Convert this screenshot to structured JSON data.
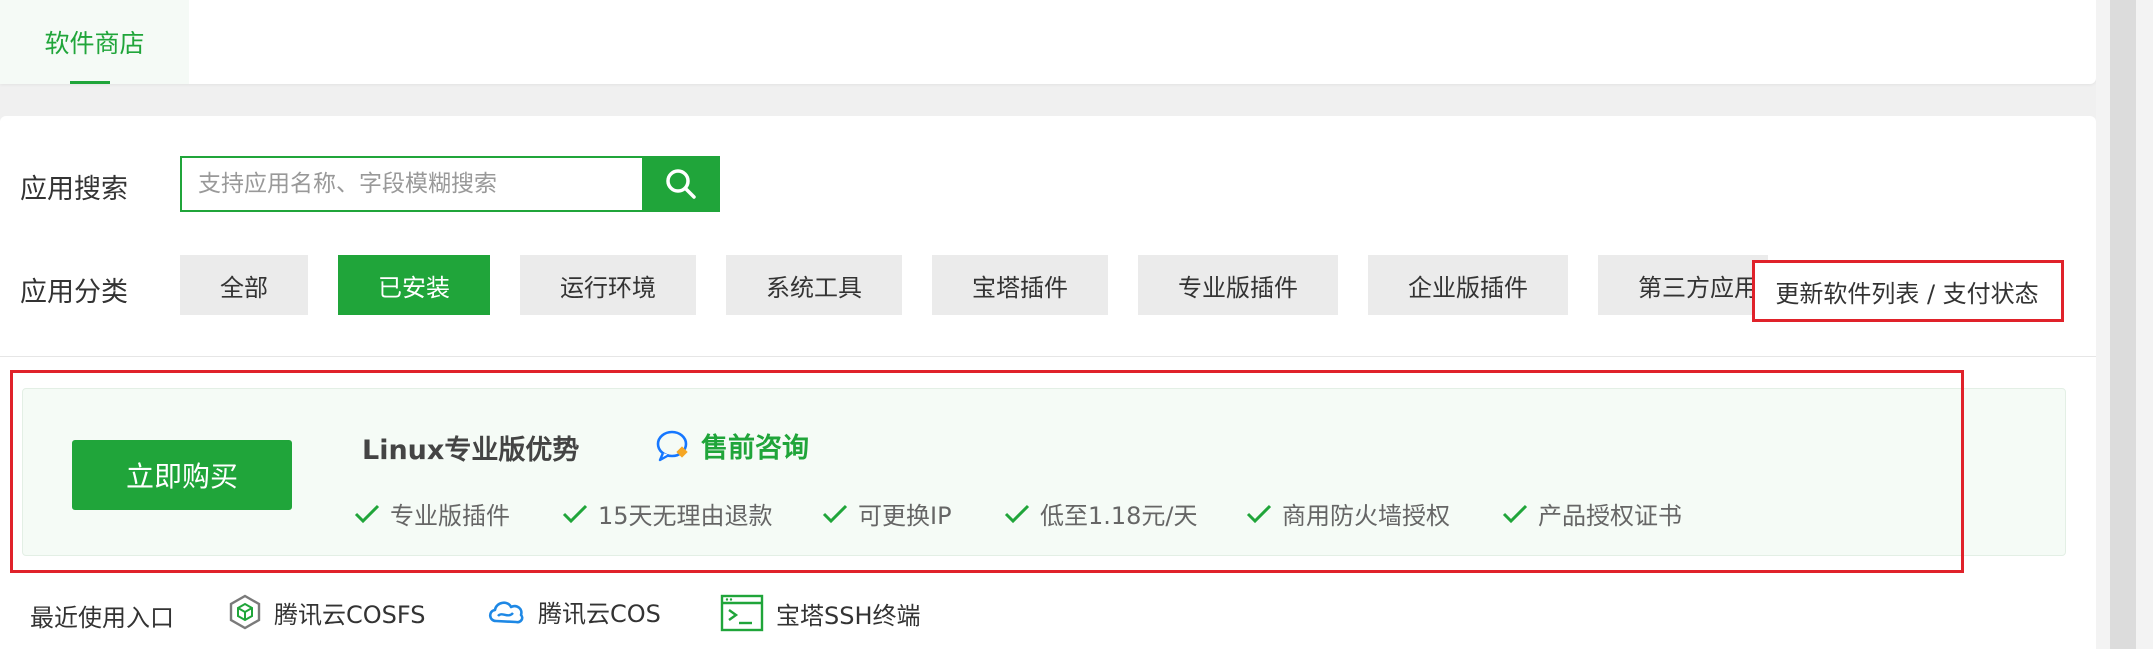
{
  "top_tabs": {
    "store": "软件商店"
  },
  "search": {
    "label": "应用搜索",
    "placeholder": "支持应用名称、字段模糊搜索",
    "value": ""
  },
  "category": {
    "label": "应用分类",
    "items": [
      {
        "label": "全部"
      },
      {
        "label": "已安装",
        "active": true
      },
      {
        "label": "运行环境"
      },
      {
        "label": "系统工具"
      },
      {
        "label": "宝塔插件"
      },
      {
        "label": "专业版插件"
      },
      {
        "label": "企业版插件"
      },
      {
        "label": "第三方应用"
      }
    ],
    "update_label": "更新软件列表 / 支付状态"
  },
  "promo": {
    "buy_label": "立即购买",
    "title": "Linux专业版优势",
    "consult_label": "售前咨询",
    "features": [
      "专业版插件",
      "15天无理由退款",
      "可更换IP",
      "低至1.18元/天",
      "商用防火墙授权",
      "产品授权证书"
    ]
  },
  "recent": {
    "label": "最近使用入口",
    "entries": [
      {
        "label": "腾讯云COSFS",
        "icon": "cube-icon"
      },
      {
        "label": "腾讯云COS",
        "icon": "cloud-icon"
      },
      {
        "label": "宝塔SSH终端",
        "icon": "terminal-icon"
      }
    ]
  },
  "colors": {
    "accent": "#20a53a",
    "highlight": "#e0222a"
  }
}
